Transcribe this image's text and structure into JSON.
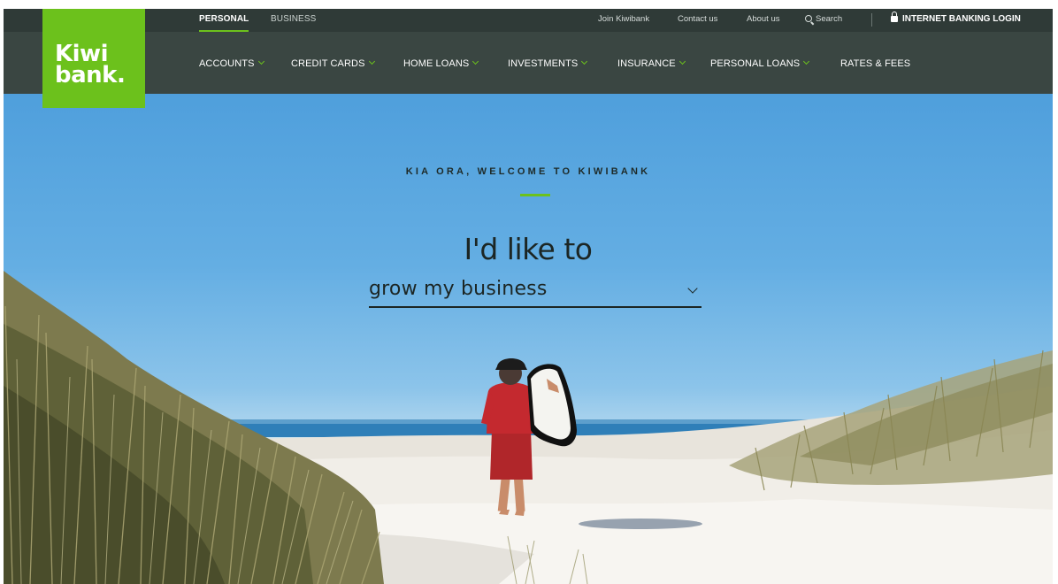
{
  "brand": {
    "logo_line1": "Kiwi",
    "logo_line2": "bank.",
    "accent": "#6cc11c",
    "header_bg": "#3a4642"
  },
  "segments": [
    {
      "label": "PERSONAL",
      "active": true
    },
    {
      "label": "BUSINESS",
      "active": false
    }
  ],
  "utility": {
    "join": "Join Kiwibank",
    "contact": "Contact us",
    "about": "About us",
    "search": "Search",
    "login": "INTERNET BANKING LOGIN"
  },
  "nav": [
    {
      "label": "ACCOUNTS",
      "has_dropdown": true
    },
    {
      "label": "CREDIT CARDS",
      "has_dropdown": true
    },
    {
      "label": "HOME LOANS",
      "has_dropdown": true
    },
    {
      "label": "INVESTMENTS",
      "has_dropdown": true
    },
    {
      "label": "INSURANCE",
      "has_dropdown": true
    },
    {
      "label": "PERSONAL LOANS",
      "has_dropdown": true
    },
    {
      "label": "RATES & FEES",
      "has_dropdown": false
    }
  ],
  "hero": {
    "welcome": "KIA ORA, WELCOME TO KIWIBANK",
    "lead": "I'd like to",
    "selector_value": "grow my business"
  }
}
